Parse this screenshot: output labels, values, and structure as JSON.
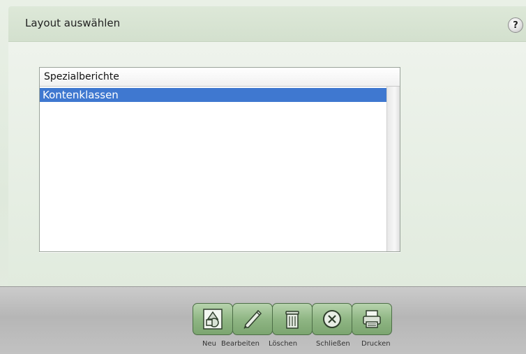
{
  "header": {
    "title": "Layout auswählen",
    "help_label": "?"
  },
  "list": {
    "header_label": "Spezialberichte",
    "items": [
      {
        "label": "Kontenklassen",
        "selected": true
      }
    ]
  },
  "toolbar": {
    "buttons": [
      {
        "label": "Neu",
        "icon": "new-document-icon"
      },
      {
        "label": "Bearbeiten",
        "icon": "pencil-icon"
      },
      {
        "label": "Löschen",
        "icon": "trash-icon"
      },
      {
        "label": "Schließen",
        "icon": "close-circle-icon"
      },
      {
        "label": "Drucken",
        "icon": "printer-icon"
      }
    ]
  },
  "colors": {
    "selection": "#3f78d0",
    "button_green": "#8fb684",
    "background": "#e8efe6"
  }
}
